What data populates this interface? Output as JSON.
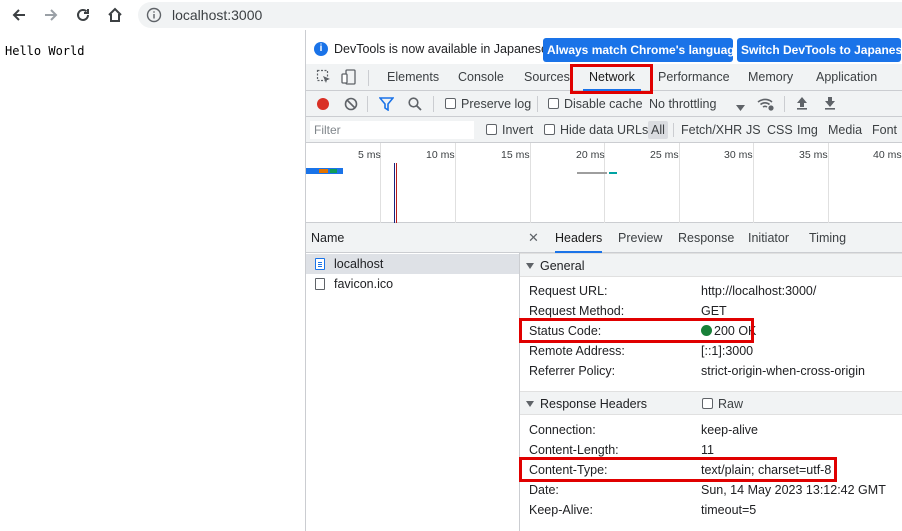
{
  "browser": {
    "url": "localhost:3000",
    "icons": {
      "back": "back-arrow-icon",
      "forward": "forward-arrow-icon",
      "reload": "reload-icon",
      "home": "home-icon",
      "info": "info-icon"
    }
  },
  "page": {
    "text": "Hello World"
  },
  "devtools": {
    "infobar": {
      "message": "DevTools is now available in Japanese!",
      "btn_match": "Always match Chrome's language",
      "btn_switch": "Switch DevTools to Japanese"
    },
    "tabs": [
      "Elements",
      "Console",
      "Sources",
      "Network",
      "Performance",
      "Memory",
      "Application"
    ],
    "active_tab": "Network",
    "toolbar": {
      "preserve_log": "Preserve log",
      "disable_cache": "Disable cache",
      "throttling": "No throttling"
    },
    "filter": {
      "placeholder": "Filter",
      "invert": "Invert",
      "hide_data_urls": "Hide data URLs",
      "types": [
        "All",
        "Fetch/XHR",
        "JS",
        "CSS",
        "Img",
        "Media",
        "Font"
      ]
    },
    "timeline_ticks": [
      "5 ms",
      "10 ms",
      "15 ms",
      "20 ms",
      "25 ms",
      "30 ms",
      "35 ms",
      "40 ms"
    ],
    "requests": {
      "header": "Name",
      "items": [
        "localhost",
        "favicon.ico"
      ]
    },
    "details": {
      "tabs": [
        "Headers",
        "Preview",
        "Response",
        "Initiator",
        "Timing"
      ],
      "general": {
        "title": "General",
        "rows": [
          {
            "key": "Request URL:",
            "value": "http://localhost:3000/"
          },
          {
            "key": "Request Method:",
            "value": "GET"
          },
          {
            "key": "Status Code:",
            "value": "200 OK"
          },
          {
            "key": "Remote Address:",
            "value": "[::1]:3000"
          },
          {
            "key": "Referrer Policy:",
            "value": "strict-origin-when-cross-origin"
          }
        ]
      },
      "response_headers": {
        "title": "Response Headers",
        "raw": "Raw",
        "rows": [
          {
            "key": "Connection:",
            "value": "keep-alive"
          },
          {
            "key": "Content-Length:",
            "value": "11"
          },
          {
            "key": "Content-Type:",
            "value": "text/plain; charset=utf-8"
          },
          {
            "key": "Date:",
            "value": "Sun, 14 May 2023 13:12:42 GMT"
          },
          {
            "key": "Keep-Alive:",
            "value": "timeout=5"
          }
        ]
      }
    }
  },
  "colors": {
    "accent": "#1a73e8",
    "highlight": "#e00000",
    "status_ok": "#188038",
    "record": "#d93025"
  }
}
